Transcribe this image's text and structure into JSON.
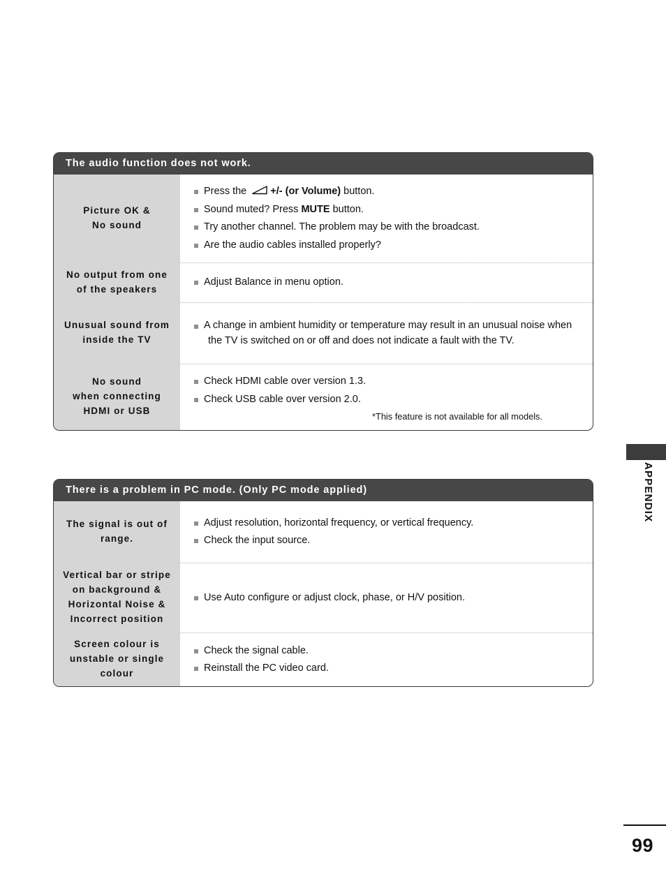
{
  "page": {
    "number": "99",
    "section_tab": "APPENDIX"
  },
  "tables": [
    {
      "id": "audio",
      "header": "The audio function does not work.",
      "rows": [
        {
          "symptom": [
            "Picture OK &",
            "No sound"
          ],
          "items": [
            {
              "pre": "Press the ",
              "icon": "volume-wedge-icon",
              "bold": "+/- (or Volume)",
              "post": " button."
            },
            {
              "pre": "Sound muted? Press ",
              "bold": "MUTE",
              "post": " button."
            },
            {
              "text": "Try another channel. The problem may be with the broadcast."
            },
            {
              "text": "Are the audio cables installed properly?"
            }
          ]
        },
        {
          "symptom": [
            "No output from one",
            "of the speakers"
          ],
          "items": [
            {
              "text": "Adjust Balance in menu option."
            }
          ]
        },
        {
          "symptom": [
            "Unusual sound from",
            "inside the TV"
          ],
          "items": [
            {
              "text": "A change in ambient humidity or temperature may result in an unusual noise when",
              "cont": "the TV is switched on or off and does not indicate a fault with the TV."
            }
          ]
        },
        {
          "symptom": [
            "No sound",
            "when connecting",
            "HDMI or USB"
          ],
          "items": [
            {
              "text": "Check HDMI cable over version 1.3."
            },
            {
              "text": "Check USB cable over version 2.0."
            }
          ],
          "footnote": "*This feature is not available for all models."
        }
      ]
    },
    {
      "id": "pc",
      "header": "There is a problem in PC mode. (Only PC mode applied)",
      "rows": [
        {
          "symptom": [
            "The signal is out of",
            "range."
          ],
          "items": [
            {
              "text": "Adjust resolution, horizontal frequency, or vertical frequency."
            },
            {
              "text": "Check the input source."
            }
          ]
        },
        {
          "symptom": [
            "Vertical bar or stripe",
            "on background &",
            "Horizontal Noise &",
            "Incorrect position"
          ],
          "items": [
            {
              "text": "Use Auto configure or adjust clock, phase, or H/V position."
            }
          ]
        },
        {
          "symptom": [
            "Screen colour is",
            "unstable or single",
            "colour"
          ],
          "items": [
            {
              "text": "Check the signal cable."
            },
            {
              "text": "Reinstall the PC video card."
            }
          ]
        }
      ]
    }
  ],
  "colors": {
    "header_bar": "#474747",
    "symptom_cell": "#d6d6d6",
    "bullet": "#8f8f8f",
    "border": "#3a3a3a",
    "text": "#111111"
  }
}
